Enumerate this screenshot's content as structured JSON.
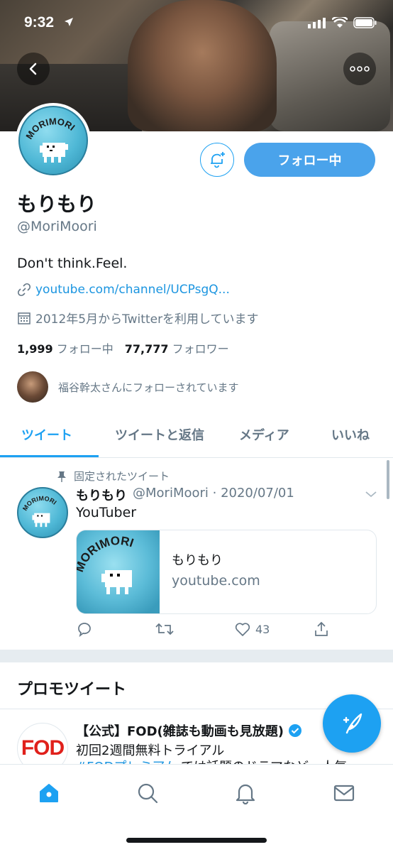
{
  "status_bar": {
    "time": "9:32"
  },
  "profile": {
    "display_name": "もりもり",
    "handle": "@MoriMoori",
    "bio": "Don't think.Feel.",
    "link": "youtube.com/channel/UCPsgQ...",
    "joined": "2012年5月からTwitterを利用しています",
    "following_count": "1,999",
    "following_label": "フォロー中",
    "followers_count": "77,777",
    "followers_label": "フォロワー",
    "followed_by": "福谷幹太さんにフォローされています",
    "follow_button": "フォロー中",
    "badge_text": "MORIMORI"
  },
  "tabs": [
    "ツイート",
    "ツイートと返信",
    "メディア",
    "いいね"
  ],
  "pinned_tweet": {
    "pinned_label": "固定されたツイート",
    "name": "もりもり",
    "meta": "@MoriMoori · 2020/07/01",
    "text": "YouTuber",
    "card_title": "もりもり",
    "card_domain": "youtube.com",
    "like_count": "43"
  },
  "promo": {
    "section_title": "プロモツイート",
    "name": "【公式】FOD(雑誌も動画も見放題)",
    "line1": "初回2週間無料トライアル",
    "hashtag": "#FODプレミアム",
    "line2_rest": "では話題のドラマなど一人気",
    "logo_text": "FOD"
  },
  "colors": {
    "accent": "#1da1f2",
    "follow_button": "#4aa3eb",
    "secondary_text": "#657786"
  },
  "icons": [
    "back-icon",
    "more-icon",
    "bell-plus-icon",
    "link-icon",
    "calendar-icon",
    "pin-icon",
    "chevron-down-icon",
    "reply-icon",
    "retweet-icon",
    "heart-icon",
    "share-icon",
    "verified-icon",
    "compose-icon",
    "home-icon",
    "search-icon",
    "notifications-icon",
    "messages-icon"
  ]
}
